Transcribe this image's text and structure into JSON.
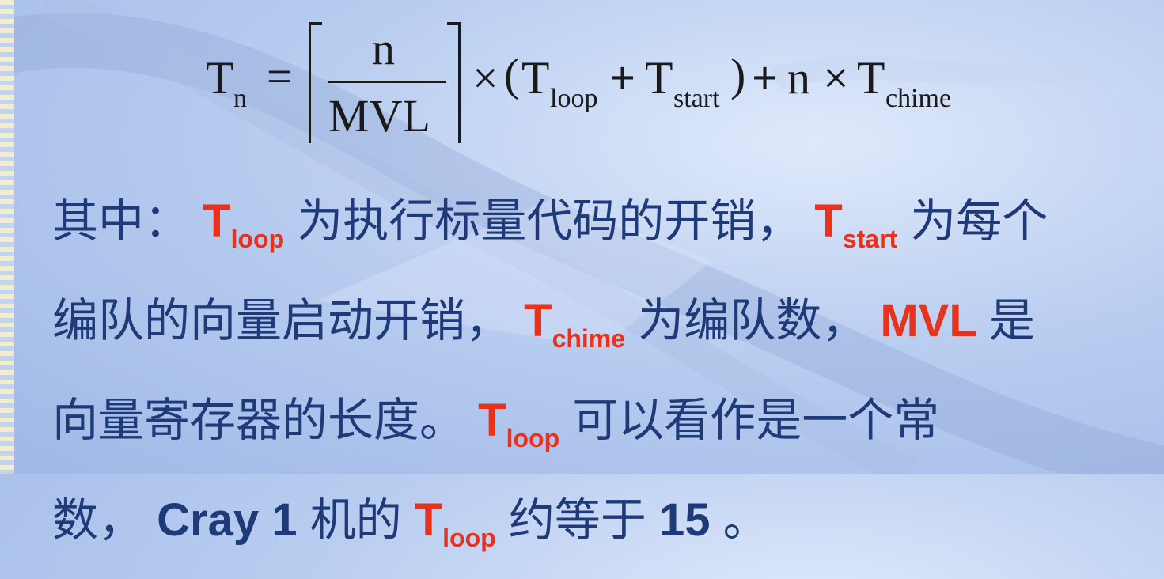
{
  "formula": {
    "lhs_T": "T",
    "lhs_sub": "n",
    "equals": "=",
    "numerator": "n",
    "denominator": "MVL",
    "times1": "×",
    "lparen": "(",
    "T1": "T",
    "T1_sub": "loop",
    "plus1": "+",
    "T2": "T",
    "T2_sub": "start",
    "rparen": ")",
    "plus2": "+",
    "n": "n",
    "times2": "×",
    "T3": "T",
    "T3_sub": "chime"
  },
  "paragraph": {
    "l1_a": "其中：",
    "l1_T1": "T",
    "l1_T1_sub": "loop",
    "l1_b": " 为执行标量代码的开销，",
    "l1_T2": "T",
    "l1_T2_sub": "start",
    "l1_c": " 为每个",
    "l2_a": "编队的向量启动开销，",
    "l2_T": "T",
    "l2_T_sub": "chime",
    "l2_b": " 为编队数，",
    "l2_MVL": "MVL",
    "l2_c": " 是",
    "l3_a": "向量寄存器的长度。",
    "l3_T": "T",
    "l3_T_sub": "loop",
    "l3_b": " 可以看作是一个常",
    "l4_a": "数，",
    "l4_cray": "Cray 1",
    "l4_b": " 机的 ",
    "l4_T": "T",
    "l4_T_sub": "loop",
    "l4_c": " 约等于 ",
    "l4_num": "15",
    "l4_d": " 。"
  }
}
